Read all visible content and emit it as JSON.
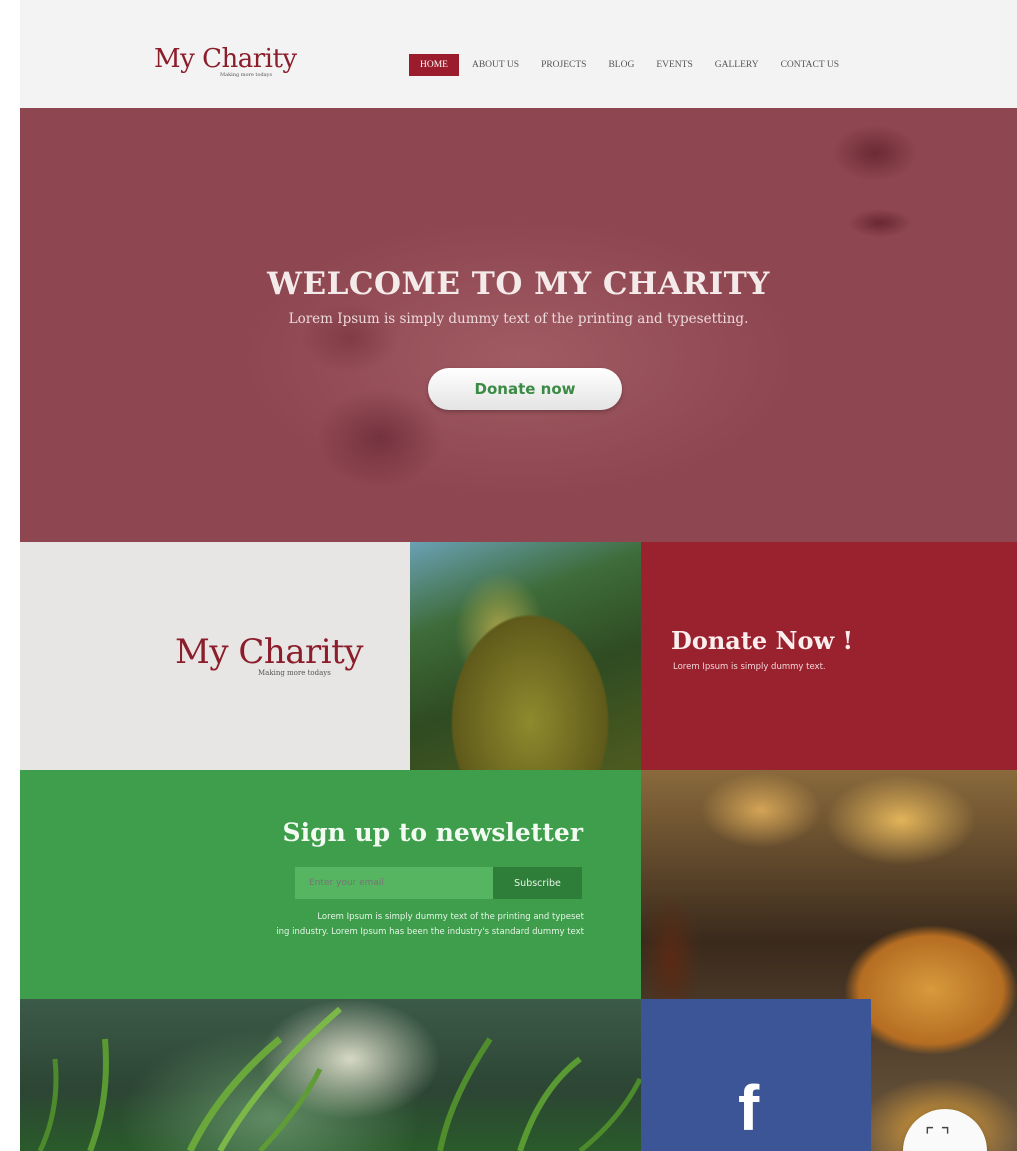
{
  "brand": {
    "logo_text": "My Charity",
    "tagline": "Making more todays",
    "primary_color": "#9b1c2c",
    "green_color": "#3e9e4c",
    "facebook_color": "#3b5597"
  },
  "nav": {
    "items": [
      {
        "label": "HOME",
        "active": true
      },
      {
        "label": "ABOUT US"
      },
      {
        "label": "PROJECTS"
      },
      {
        "label": "BLOG"
      },
      {
        "label": "EVENTS"
      },
      {
        "label": "GALLERY"
      },
      {
        "label": "CONTACT US"
      }
    ]
  },
  "hero": {
    "title": "WELCOME TO MY CHARITY",
    "subtitle": "Lorem Ipsum is simply dummy text of the printing and typesetting.",
    "button_label": "Donate now"
  },
  "donate_tile": {
    "title": "Donate Now !",
    "text": "Lorem Ipsum is simply dummy text."
  },
  "newsletter": {
    "title": "Sign up to newsletter",
    "input_placeholder": "Enter your email",
    "button_label": "Subscribe",
    "text_line1": "Lorem Ipsum is simply dummy text of the printing and typeset",
    "text_line2": "ing industry. Lorem Ipsum has been the industry's standard dummy text"
  },
  "social": {
    "facebook_glyph": "f",
    "facebook_icon": "facebook-icon"
  },
  "corner_button": {
    "icon": "expand-icon",
    "glyph": "⌜ ⌝"
  }
}
